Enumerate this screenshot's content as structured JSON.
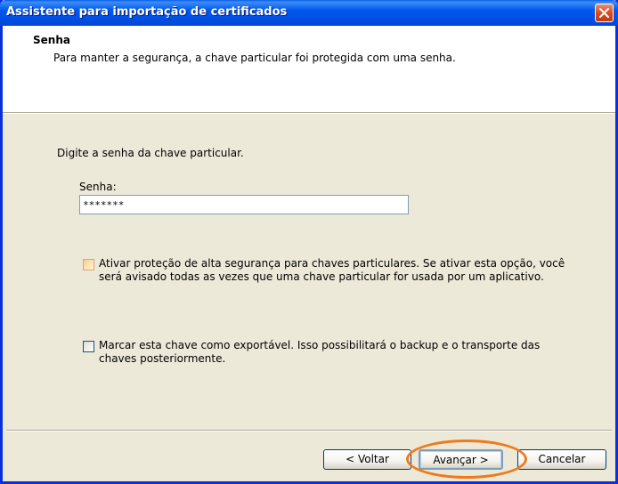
{
  "window": {
    "title": "Assistente para importação de certificados",
    "accent": "#0058ee",
    "close_color": "#d94b22"
  },
  "header": {
    "title": "Senha",
    "description": "Para manter a segurança, a chave particular foi protegida com uma senha."
  },
  "content": {
    "prompt": "Digite a senha da chave particular.",
    "password_label": "Senha:",
    "password_value": "*******",
    "options": [
      {
        "label": "Ativar proteção de alta segurança para chaves particulares. Se ativar esta opção, você será avisado todas as vezes que uma chave particular for usada por um aplicativo.",
        "checked": false
      },
      {
        "label": "Marcar esta chave como exportável. Isso possibilitará o backup e o transporte das chaves posteriormente.",
        "checked": false
      }
    ]
  },
  "buttons": {
    "back": "< Voltar",
    "next": "Avançar >",
    "cancel": "Cancelar"
  },
  "annotation": {
    "highlight_color": "#ee7a1e",
    "highlighted": "next"
  }
}
